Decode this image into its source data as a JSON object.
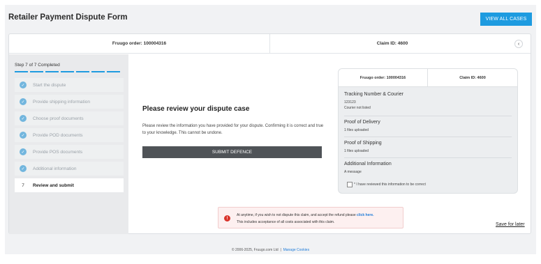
{
  "header": {
    "title": "Retailer Payment Dispute Form",
    "view_all_label": "VIEW ALL CASES"
  },
  "case_bar": {
    "order": "Fruugo order: 100004316",
    "claim": "Claim ID: 4600",
    "collapse_icon": "chevron-left-icon"
  },
  "sidebar": {
    "status": "Step 7 of 7 Completed",
    "progress_segments": 7,
    "steps": [
      {
        "label": "Start the dispute",
        "done": true
      },
      {
        "label": "Provide shipping information",
        "done": true
      },
      {
        "label": "Choose proof documents",
        "done": true
      },
      {
        "label": "Provide POD documents",
        "done": true
      },
      {
        "label": "Provide POS documents",
        "done": true
      },
      {
        "label": "Additional information",
        "done": true
      },
      {
        "number": "7",
        "label": "Review and submit",
        "done": false
      }
    ]
  },
  "main": {
    "heading": "Please review your dispute case",
    "description": "Please review the information you have provided for your dispute. Confirming it is correct and true to your knowledge. This cannot be undone.",
    "submit_label": "SUBMIT DEFENCE"
  },
  "summary": {
    "order": "Fruugo order: 100004316",
    "claim": "Claim ID: 4600",
    "tracking": {
      "heading": "Tracking Number & Courier",
      "number": "123123",
      "courier": "Courier not listed"
    },
    "delivery": {
      "heading": "Proof of Delivery",
      "files": "1 files uploaded"
    },
    "shipping": {
      "heading": "Proof of Shipping",
      "files": "1 files uploaded"
    },
    "additional": {
      "heading": "Additional Information",
      "message": "A message"
    },
    "confirm_label": "* I have reviewed this information to be correct"
  },
  "alert": {
    "icon": "exclamation-icon",
    "line1": "At anytime, if you wish to not dispute this claim, and accept the refund please",
    "link": "click here.",
    "line2": "This includes acceptance of all costs associated with this claim."
  },
  "save_later_label": "Save for later",
  "footer": {
    "copyright": "© 2006-2025, Fruugo.com Ltd",
    "separator": "|",
    "manage_cookies": "Manage Cookies"
  },
  "colors": {
    "accent": "#1e9be0",
    "check": "#72b6de",
    "submit": "#4f5357",
    "alert_icon": "#d9342b"
  }
}
